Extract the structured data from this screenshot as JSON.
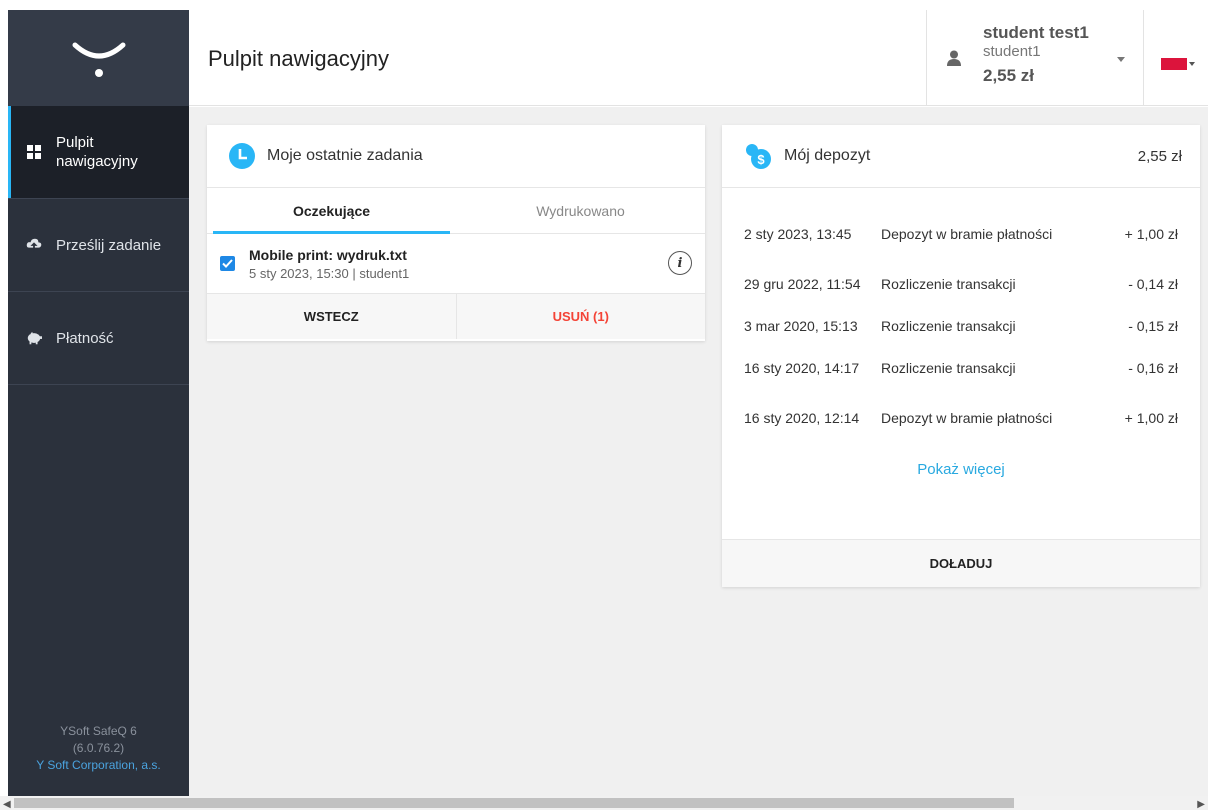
{
  "app": {
    "product": "YSoft SafeQ 6",
    "version": "(6.0.76.2)",
    "company": "Y Soft Corporation, a.s."
  },
  "sidebar": {
    "logo_icon": "ysoft-logo-icon",
    "items": [
      {
        "label": "Pulpit nawigacyjny",
        "icon": "dashboard-grid-icon",
        "active": true
      },
      {
        "label": "Prześlij zadanie",
        "icon": "cloud-upload-icon",
        "active": false
      },
      {
        "label": "Płatność",
        "icon": "piggy-bank-icon",
        "active": false
      }
    ]
  },
  "header": {
    "title": "Pulpit nawigacyjny",
    "user": {
      "name": "student test1",
      "login": "student1",
      "balance": "2,55 zł"
    },
    "language_flag": "polish-flag"
  },
  "tasks": {
    "title": "Moje ostatnie zadania",
    "tabs": [
      {
        "label": "Oczekujące",
        "active": true
      },
      {
        "label": "Wydrukowano",
        "active": false
      }
    ],
    "jobs": [
      {
        "name": "Mobile print: wydruk.txt",
        "meta": "5 sty 2023, 15:30 | student1",
        "checked": true
      }
    ],
    "back_label": "WSTECZ",
    "delete_label": "USUŃ (1)"
  },
  "deposit": {
    "title": "Mój depozyt",
    "amount": "2,55 zł",
    "transactions": [
      {
        "date": "2 sty 2023, 13:45",
        "description": "Depozyt w bramie płatności",
        "amount": "+ 1,00 zł"
      },
      {
        "date": "29 gru 2022, 11:54",
        "description": "Rozliczenie transakcji",
        "amount": "- 0,14 zł"
      },
      {
        "date": "3 mar 2020, 15:13",
        "description": "Rozliczenie transakcji",
        "amount": "- 0,15 zł"
      },
      {
        "date": "16 sty 2020, 14:17",
        "description": "Rozliczenie transakcji",
        "amount": "- 0,16 zł"
      },
      {
        "date": "16 sty 2020, 12:14",
        "description": "Depozyt w bramie płatności",
        "amount": "+ 1,00 zł"
      }
    ],
    "show_more": "Pokaż więcej",
    "topup_label": "DOŁADUJ"
  },
  "colors": {
    "accent": "#29b6f6",
    "sidebar_bg": "#2b313c",
    "danger": "#f44336",
    "link": "#29a9e0"
  }
}
